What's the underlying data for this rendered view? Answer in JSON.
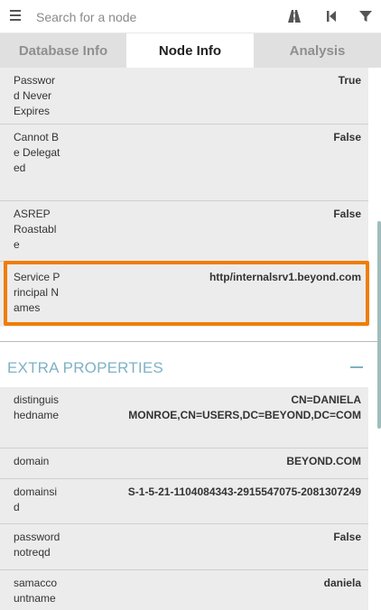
{
  "search": {
    "placeholder": "Search for a node"
  },
  "icons": {
    "menu": "hamburger-menu-icon",
    "pathfinding": "road-icon",
    "back": "step-backward-icon",
    "filter": "filter-icon"
  },
  "tabs": [
    {
      "label": "Database Info",
      "active": false
    },
    {
      "label": "Node Info",
      "active": true
    },
    {
      "label": "Analysis",
      "active": false
    }
  ],
  "node_properties": [
    {
      "key": "Password Never Expires",
      "value": "True"
    },
    {
      "key": "Cannot Be Delegated",
      "value": "False"
    },
    {
      "key": "ASREP Roastable",
      "value": "False"
    },
    {
      "key": "Service Principal Names",
      "value": "http/internalsrv1.beyond.com"
    }
  ],
  "extra_properties": {
    "title": "EXTRA PROPERTIES",
    "rows": [
      {
        "key": "distinguishedname",
        "value": "CN=DANIELA MONROE,CN=USERS,DC=BEYOND,DC=COM"
      },
      {
        "key": "domain",
        "value": "BEYOND.COM"
      },
      {
        "key": "domainsid",
        "value": "S-1-5-21-1104084343-2915547075-2081307249"
      },
      {
        "key": "passwordnotreqd",
        "value": "False"
      },
      {
        "key": "samaccountname",
        "value": "daniela"
      }
    ]
  },
  "colors": {
    "highlight": "#f07d00",
    "section_title": "#7fb2c6",
    "row_background": "#ececec"
  }
}
